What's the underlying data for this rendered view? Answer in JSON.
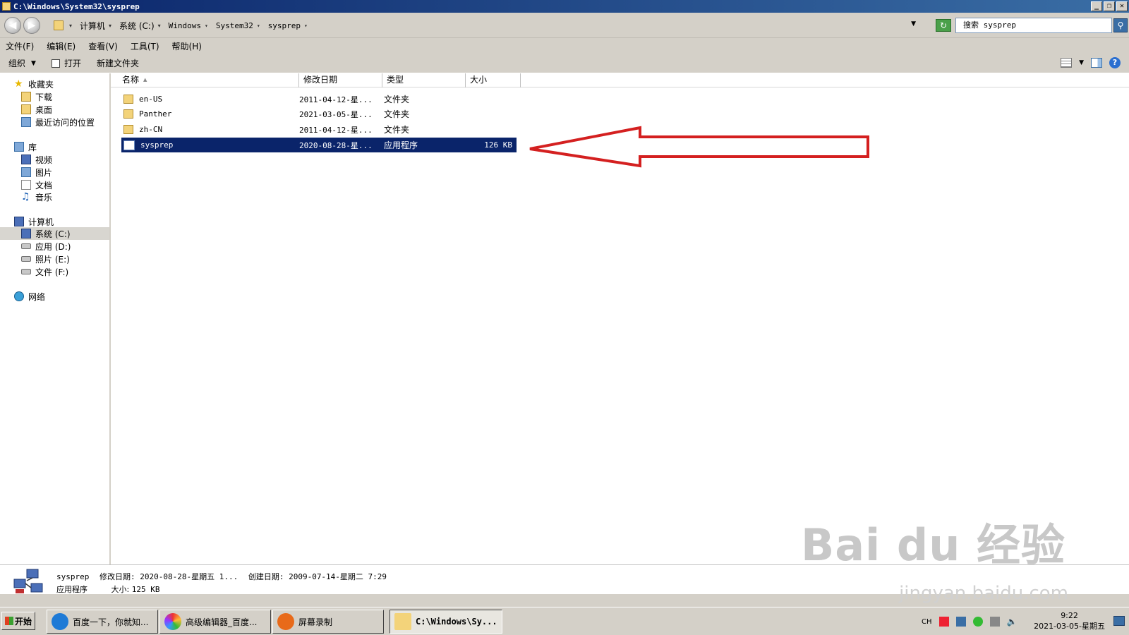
{
  "window": {
    "title": "C:\\Windows\\System32\\sysprep",
    "controls": {
      "minimize": "_",
      "restore": "❐",
      "close": "✕"
    }
  },
  "address": {
    "crumbs": [
      "计算机",
      "系统 (C:)",
      "Windows",
      "System32",
      "sysprep"
    ],
    "search_text": "搜索 sysprep"
  },
  "menu": [
    "文件(F)",
    "编辑(E)",
    "查看(V)",
    "工具(T)",
    "帮助(H)"
  ],
  "toolbar": {
    "organize": "组织",
    "open": "打开",
    "new_folder": "新建文件夹"
  },
  "sidebar": {
    "favorites": {
      "label": "收藏夹",
      "items": [
        "下载",
        "桌面",
        "最近访问的位置"
      ]
    },
    "libraries": {
      "label": "库",
      "items": [
        "视频",
        "图片",
        "文档",
        "音乐"
      ]
    },
    "computer": {
      "label": "计算机",
      "items": [
        "系统 (C:)",
        "应用 (D:)",
        "照片 (E:)",
        "文件 (F:)"
      ]
    },
    "network": {
      "label": "网络"
    }
  },
  "columns": {
    "name": "名称",
    "date": "修改日期",
    "type": "类型",
    "size": "大小"
  },
  "files": [
    {
      "name": "en-US",
      "date": "2011-04-12-星...",
      "type": "文件夹",
      "size": ""
    },
    {
      "name": "Panther",
      "date": "2021-03-05-星...",
      "type": "文件夹",
      "size": ""
    },
    {
      "name": "zh-CN",
      "date": "2011-04-12-星...",
      "type": "文件夹",
      "size": ""
    },
    {
      "name": "sysprep",
      "date": "2020-08-28-星...",
      "type": "应用程序",
      "size": "126 KB",
      "selected": true
    }
  ],
  "details": {
    "name": "sysprep",
    "modified_label": "修改日期:",
    "modified": "2020-08-28-星期五 1...",
    "created_label": "创建日期:",
    "created": "2009-07-14-星期二 7:29",
    "type": "应用程序",
    "size_label": "大小:",
    "size": "125 KB"
  },
  "watermark": {
    "main": "Bai du 经验",
    "sub": "jingyan.baidu.com"
  },
  "taskbar": {
    "start": "开始",
    "tasks": [
      "百度一下，你就知...",
      "高级编辑器_百度...",
      "屏幕录制",
      "C:\\Windows\\Sy..."
    ],
    "lang": "CH",
    "time": "9:22",
    "date": "2021-03-05-星期五"
  },
  "colors": {
    "selection": "#0a246a",
    "annotation_arrow": "#d42020",
    "titlebar": "#0a246a"
  }
}
